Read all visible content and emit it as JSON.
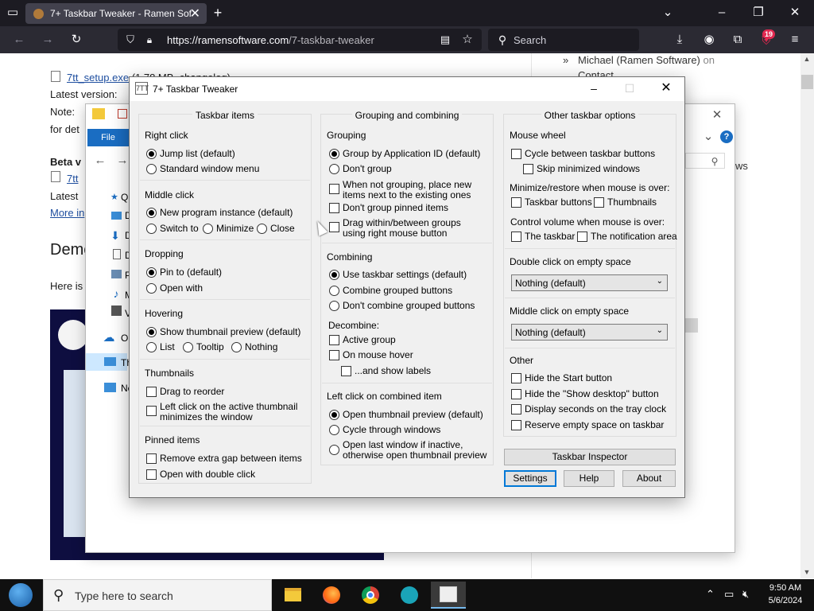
{
  "browser": {
    "tab_title": "7+ Taskbar Tweaker - Ramen Sof",
    "url_host": "https://ramensoftware.com",
    "url_path": "/7-taskbar-tweaker",
    "search_placeholder": "Search",
    "extensions_badge": "19"
  },
  "page": {
    "setup_link": "7tt_setup.exe",
    "setup_meta": "(1.78 MB, changelog)",
    "latest_version": "Latest version:",
    "note": "Note:",
    "for_det": "for det",
    "beta": "Beta v",
    "beta_link": "7tt",
    "latest": "Latest",
    "more_info": "More in",
    "demo_heading": "Demo",
    "here_is": "Here is",
    "sidebar_author": "Michael (Ramen Software)",
    "sidebar_on": "on",
    "sidebar_contact": "Contact",
    "sidebar_ws": "ws"
  },
  "explorer": {
    "file_tab": "File",
    "nav_items": [
      {
        "label": "Q"
      },
      {
        "label": "D"
      },
      {
        "label": "D"
      },
      {
        "label": "D"
      },
      {
        "label": "P"
      },
      {
        "label": "M"
      },
      {
        "label": "V"
      },
      {
        "label": "O"
      },
      {
        "label": "Th"
      },
      {
        "label": "Ne"
      }
    ]
  },
  "dialog": {
    "title": "7+ Taskbar Tweaker",
    "icon_text": "7TT",
    "col1": {
      "heading": "Taskbar items",
      "right_click": {
        "label": "Right click",
        "options": [
          "Jump list (default)",
          "Standard window menu"
        ]
      },
      "middle_click": {
        "label": "Middle click",
        "opt1": "New program instance (default)",
        "opt2": "Switch to",
        "opt3": "Minimize",
        "opt4": "Close"
      },
      "dropping": {
        "label": "Dropping",
        "options": [
          "Pin to (default)",
          "Open with"
        ]
      },
      "hovering": {
        "label": "Hovering",
        "opt1": "Show thumbnail preview (default)",
        "opt2": "List",
        "opt3": "Tooltip",
        "opt4": "Nothing"
      },
      "thumbnails": {
        "label": "Thumbnails",
        "opt1": "Drag to reorder",
        "opt2a": "Left click on the active thumbnail",
        "opt2b": "minimizes the window"
      },
      "pinned": {
        "label": "Pinned items",
        "opt1": "Remove extra gap between items",
        "opt2": "Open with double click"
      }
    },
    "col2": {
      "heading": "Grouping and combining",
      "grouping": {
        "label": "Grouping",
        "opt1": "Group by Application ID (default)",
        "opt2": "Don't group",
        "opt3a": "When not grouping, place new",
        "opt3b": "items next to the existing ones",
        "opt4": "Don't group pinned items",
        "opt5a": "Drag within/between groups",
        "opt5b": "using right mouse button"
      },
      "combining": {
        "label": "Combining",
        "options": [
          "Use taskbar settings (default)",
          "Combine grouped buttons",
          "Don't combine grouped buttons"
        ]
      },
      "decombine": {
        "label": "Decombine:",
        "opt1": "Active group",
        "opt2": "On mouse hover",
        "opt3": "...and show labels"
      },
      "left_click": {
        "label": "Left click on combined item",
        "opt1": "Open thumbnail preview (default)",
        "opt2": "Cycle through windows",
        "opt3a": "Open last window if inactive,",
        "opt3b": "otherwise open thumbnail preview"
      }
    },
    "col3": {
      "heading": "Other taskbar options",
      "mouse_wheel": {
        "label": "Mouse wheel",
        "opt1": "Cycle between taskbar buttons",
        "opt2": "Skip minimized windows"
      },
      "min_restore": {
        "label": "Minimize/restore when mouse is over:",
        "opt1": "Taskbar buttons",
        "opt2": "Thumbnails"
      },
      "volume": {
        "label": "Control volume when mouse is over:",
        "opt1": "The taskbar",
        "opt2": "The notification area"
      },
      "double_click": {
        "label": "Double click on empty space",
        "value": "Nothing (default)"
      },
      "middle_empty": {
        "label": "Middle click on empty space",
        "value": "Nothing (default)"
      },
      "other": {
        "label": "Other",
        "options": [
          "Hide the Start button",
          "Hide the \"Show desktop\" button",
          "Display seconds on the tray clock",
          "Reserve empty space on taskbar"
        ]
      }
    },
    "inspector_button": "Taskbar Inspector",
    "settings_button": "Settings",
    "help_button": "Help",
    "about_button": "About"
  },
  "taskbar": {
    "search_placeholder": "Type here to search",
    "time": "9:50 AM",
    "date": "5/6/2024"
  },
  "colors": {
    "accent": "#0078d7",
    "browser_dark": "#1c1b22",
    "toolbar": "#2b2a33",
    "dialog_bg": "#f0f0f0"
  }
}
